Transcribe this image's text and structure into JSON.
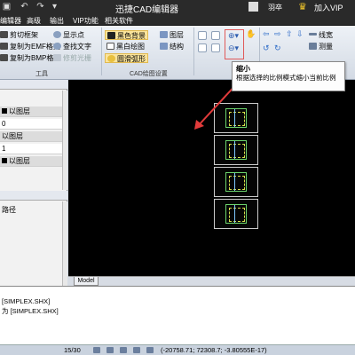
{
  "titlebar": {
    "app_title": "迅捷CAD编辑器",
    "user_name": "羽卒",
    "vip_label": "加入VIP",
    "quick_icons": [
      "save-icon",
      "undo-icon",
      "redo-icon",
      "dropdown-icon"
    ],
    "accent_color": "#f3c82b"
  },
  "menu": {
    "items": [
      "编辑器",
      "高级",
      "输出",
      "VIP功能",
      "相关软件"
    ]
  },
  "ribbon": {
    "tools_group": {
      "label": "工具",
      "items": [
        "剪切框架",
        "复制为EMF格式",
        "复制为BMP格式",
        "显示点",
        "查找文字",
        "修剪光栅"
      ]
    },
    "draw_settings_group": {
      "label": "CAD绘图设置",
      "items": [
        "黑色背景",
        "黑白绘图",
        "圆滑弧形",
        "图层",
        "结构"
      ]
    },
    "right_items": [
      "线宽",
      "测量"
    ]
  },
  "tooltip": {
    "title": "缩小",
    "description": "根据选择的比例模式缩小当前比例"
  },
  "layer_panel": {
    "rows": [
      "以图层",
      "0",
      "以图层",
      "1",
      "以图层"
    ],
    "path_label": "路径"
  },
  "canvas": {
    "model_tab": "Model",
    "thumbnail_count": 4
  },
  "command": {
    "lines": [
      "[SIMPLEX.SHX]",
      "为 [SIMPLEX.SHX]"
    ]
  },
  "status": {
    "page": "15/30",
    "coords": "(-20758.71; 72308.7; -3.80555E-17)"
  }
}
